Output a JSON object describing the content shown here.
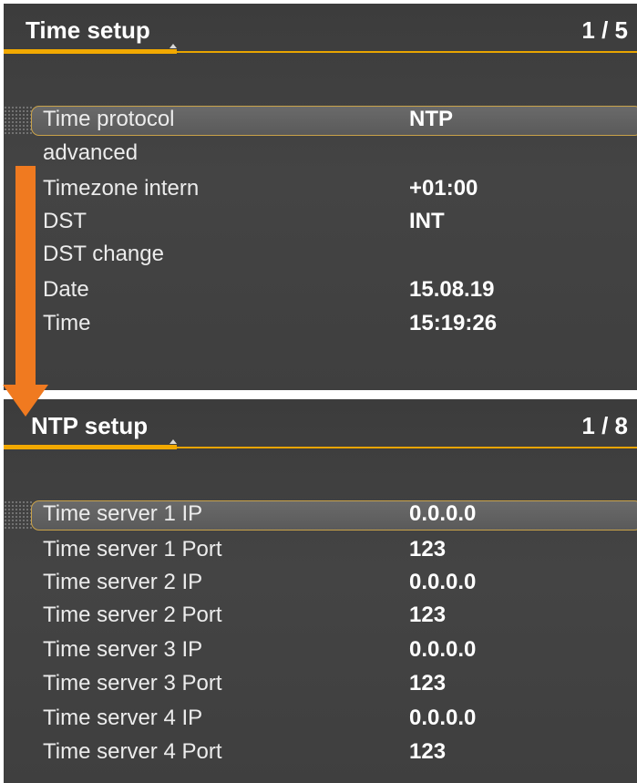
{
  "time_setup": {
    "title": "Time setup",
    "page": "1 / 5",
    "rows": [
      {
        "label": "Time protocol",
        "value": "NTP"
      },
      {
        "label": "advanced",
        "value": ""
      },
      {
        "label": "Timezone intern",
        "value": "+01:00"
      },
      {
        "label": "DST",
        "value": "INT"
      },
      {
        "label": "DST change",
        "value": ""
      },
      {
        "label": "Date",
        "value": "15.08.19"
      },
      {
        "label": "Time",
        "value": "15:19:26"
      }
    ]
  },
  "ntp_setup": {
    "title": "NTP setup",
    "page": "1 / 8",
    "rows": [
      {
        "label": "Time server 1 IP",
        "value": "0.0.0.0"
      },
      {
        "label": "Time server 1 Port",
        "value": "123"
      },
      {
        "label": "Time server 2 IP",
        "value": "0.0.0.0"
      },
      {
        "label": "Time server 2 Port",
        "value": "123"
      },
      {
        "label": "Time server 3 IP",
        "value": "0.0.0.0"
      },
      {
        "label": "Time server 3 Port",
        "value": "123"
      },
      {
        "label": "Time server 4 IP",
        "value": "0.0.0.0"
      },
      {
        "label": "Time server 4 Port",
        "value": "123"
      }
    ]
  },
  "colors": {
    "accent": "#f2a900",
    "arrow": "#f07a20",
    "panel_bg": "#404040",
    "selection_border": "#c9a24a"
  }
}
